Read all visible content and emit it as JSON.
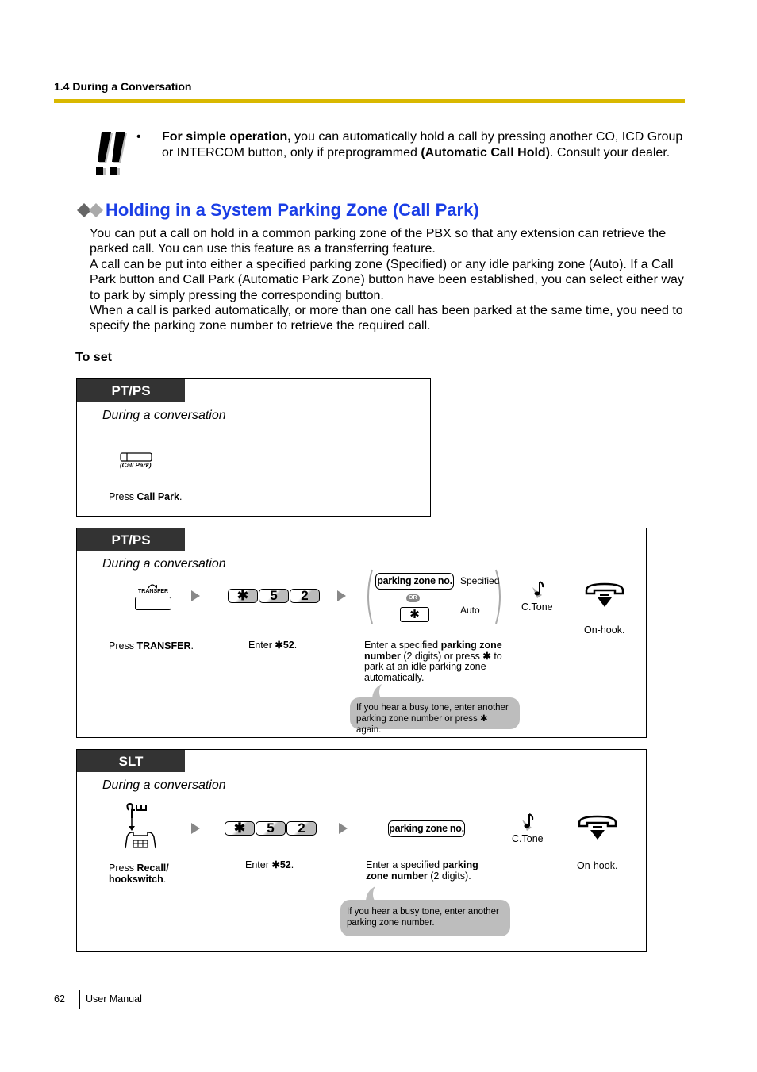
{
  "header": {
    "section": "1.4 During a Conversation",
    "rule_color": "#d9b800"
  },
  "note": {
    "icon": "double-exclamation-icon",
    "bullet": "•",
    "bold_lead": "For simple operation,",
    "text_1": " you can automatically hold a call by pressing another CO, ICD Group or INTERCOM button, only if preprogrammed ",
    "bold_mid": "(Automatic Call Hold)",
    "text_2": ". Consult your dealer."
  },
  "section": {
    "icon": "double-diamond-icon",
    "title": "Holding in a System Parking Zone (Call Park)",
    "title_color": "#1a3ee6",
    "paragraphs": [
      "You can put a call on hold in a common parking zone of the PBX so that any extension can retrieve the parked call. You can use this feature as a transferring feature.",
      "A call can be put into either a specified parking zone (Specified) or any idle parking zone (Auto). If a Call Park button and Call Park (Automatic Park Zone) button have been established, you can select either way to park by simply pressing the corresponding button.",
      "When a call is parked automatically, or more than one call has been parked at the same time, you need to specify the parking zone number to retrieve the required call."
    ],
    "subheading": "To set"
  },
  "box1": {
    "badge": "PT/PS",
    "during": "During a conversation",
    "button_label": "(Call Park)",
    "caption_pre": "Press ",
    "caption_bold": "Call Park",
    "caption_post": "."
  },
  "box2": {
    "badge": "PT/PS",
    "during": "During a conversation",
    "transfer_label": "TRANSFER",
    "keys": [
      "✱",
      "5",
      "2"
    ],
    "pz_label": "parking zone no.",
    "or_label": "OR",
    "star_key": "✱",
    "specified": "Specified",
    "auto": "Auto",
    "ctone": "C.Tone",
    "onhook": "On-hook.",
    "cap1_pre": "Press ",
    "cap1_bold": "TRANSFER",
    "cap1_post": ".",
    "cap2_pre": "Enter ",
    "cap2_bold": "✱52",
    "cap2_post": ".",
    "cap3_pre": "Enter a specified ",
    "cap3_bold1": "parking zone number",
    "cap3_mid": " (2 digits) or press ",
    "cap3_star": "✱",
    "cap3_post": " to park at an idle parking zone automatically.",
    "bubble": "If you hear a busy tone, enter another parking zone number or press ✱ again."
  },
  "box3": {
    "badge": "SLT",
    "during": "During a conversation",
    "keys": [
      "✱",
      "5",
      "2"
    ],
    "pz_label": "parking zone no.",
    "ctone": "C.Tone",
    "onhook": "On-hook.",
    "cap1_pre": "Press ",
    "cap1_bold": "Recall/ hookswitch",
    "cap1_post": ".",
    "cap2_pre": "Enter ",
    "cap2_bold": "✱52",
    "cap2_post": ".",
    "cap3_pre": "Enter a specified ",
    "cap3_bold": "parking zone number",
    "cap3_post": " (2 digits).",
    "bubble": "If you hear a busy tone, enter another parking zone number."
  },
  "footer": {
    "page": "62",
    "label": "User Manual"
  }
}
